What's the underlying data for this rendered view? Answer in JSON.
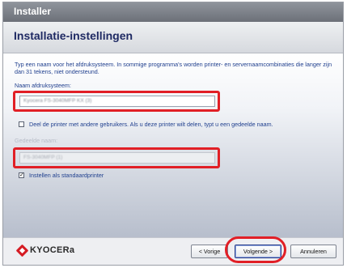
{
  "window": {
    "title": "Installer"
  },
  "header": {
    "heading": "Installatie-instellingen"
  },
  "form": {
    "description": "Typ een naam voor het afdruksysteem. In sommige programma's worden printer- en servernaamcombinaties die langer zijn dan 31 tekens, niet ondersteund.",
    "printer_name_label": "Naam afdruksysteem:",
    "printer_name_value": "Kyocera FS-3040MFP KX (3)",
    "share_label": "Deel de printer met andere gebruikers. Als u deze printer wilt delen, typt u een gedeelde naam.",
    "share_checked": false,
    "shared_name_label": "Gedeelde naam:",
    "shared_name_value": "FS-3040MFP (1)",
    "default_label": "Instellen als standaardprinter",
    "default_checked": true,
    "check_glyph": "✓"
  },
  "footer": {
    "logo_text": "KYOCERa",
    "back_label": "< Vorige",
    "next_label": "Volgende >",
    "cancel_label": "Annuleren"
  },
  "colors": {
    "highlight": "#e11f26",
    "label_text": "#1f3f8e",
    "heading_text": "#1f2a63",
    "brand": "#d51c24"
  }
}
